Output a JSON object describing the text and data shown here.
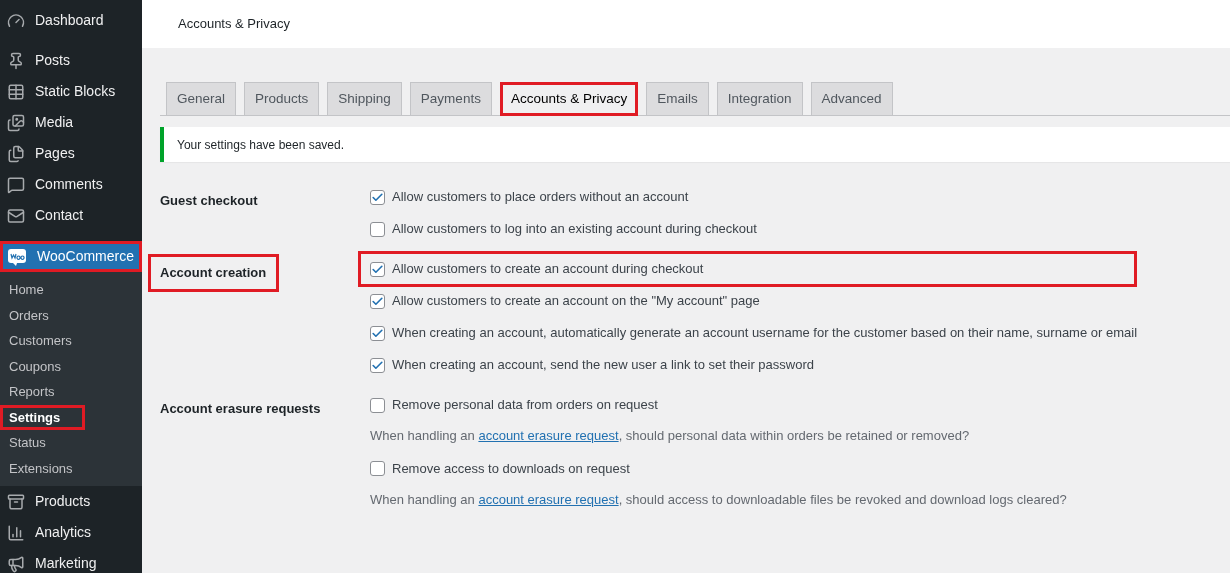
{
  "sidebar": {
    "sections": [
      {
        "items": [
          {
            "label": "Dashboard",
            "selected": false,
            "highlighted": false
          }
        ]
      },
      {
        "items": [
          {
            "label": "Posts",
            "selected": false,
            "highlighted": false
          },
          {
            "label": "Static Blocks",
            "selected": false,
            "highlighted": false
          },
          {
            "label": "Media",
            "selected": false,
            "highlighted": false
          },
          {
            "label": "Pages",
            "selected": false,
            "highlighted": false
          },
          {
            "label": "Comments",
            "selected": false,
            "highlighted": false
          },
          {
            "label": "Contact",
            "selected": false,
            "highlighted": false
          }
        ]
      },
      {
        "items": [
          {
            "label": "WooCommerce",
            "selected": true,
            "highlighted": true,
            "children": [
              {
                "label": "Home",
                "selected": false,
                "highlighted": false
              },
              {
                "label": "Orders",
                "selected": false,
                "highlighted": false
              },
              {
                "label": "Customers",
                "selected": false,
                "highlighted": false
              },
              {
                "label": "Coupons",
                "selected": false,
                "highlighted": false
              },
              {
                "label": "Reports",
                "selected": false,
                "highlighted": false
              },
              {
                "label": "Settings",
                "selected": true,
                "highlighted": true
              },
              {
                "label": "Status",
                "selected": false,
                "highlighted": false
              },
              {
                "label": "Extensions",
                "selected": false,
                "highlighted": false
              }
            ]
          },
          {
            "label": "Products",
            "selected": false,
            "highlighted": false
          },
          {
            "label": "Analytics",
            "selected": false,
            "highlighted": false
          },
          {
            "label": "Marketing",
            "selected": false,
            "highlighted": false
          }
        ]
      }
    ]
  },
  "header": {
    "title": "Accounts & Privacy"
  },
  "tabs": [
    {
      "label": "General",
      "selected": false,
      "highlighted": false
    },
    {
      "label": "Products",
      "selected": false,
      "highlighted": false
    },
    {
      "label": "Shipping",
      "selected": false,
      "highlighted": false
    },
    {
      "label": "Payments",
      "selected": false,
      "highlighted": false
    },
    {
      "label": "Accounts & Privacy",
      "selected": true,
      "highlighted": true
    },
    {
      "label": "Emails",
      "selected": false,
      "highlighted": false
    },
    {
      "label": "Integration",
      "selected": false,
      "highlighted": false
    },
    {
      "label": "Advanced",
      "selected": false,
      "highlighted": false
    }
  ],
  "notice": {
    "text": "Your settings have been saved."
  },
  "sections": [
    {
      "label": "Guest checkout",
      "highlighted": false,
      "options": [
        {
          "label": "Allow customers to place orders without an account",
          "checked": true,
          "highlighted": false
        },
        {
          "label": "Allow customers to log into an existing account during checkout",
          "checked": false,
          "highlighted": false
        }
      ]
    },
    {
      "label": "Account creation",
      "highlighted": true,
      "options": [
        {
          "label": "Allow customers to create an account during checkout",
          "checked": true,
          "highlighted": true
        },
        {
          "label": "Allow customers to create an account on the \"My account\" page",
          "checked": true,
          "highlighted": false
        },
        {
          "label": "When creating an account, automatically generate an account username for the customer based on their name, surname or email",
          "checked": true,
          "highlighted": false
        },
        {
          "label": "When creating an account, send the new user a link to set their password",
          "checked": true,
          "highlighted": false
        }
      ]
    },
    {
      "label": "Account erasure requests",
      "highlighted": false,
      "options": [
        {
          "label": "Remove personal data from orders on request",
          "checked": false,
          "highlighted": false,
          "help": {
            "before": "When handling an ",
            "link": "account erasure request",
            "after": ", should personal data within orders be retained or removed?"
          }
        },
        {
          "label": "Remove access to downloads on request",
          "checked": false,
          "highlighted": false,
          "help": {
            "before": "When handling an ",
            "link": "account erasure request",
            "after": ", should access to downloadable files be revoked and download logs cleared?"
          }
        }
      ]
    }
  ]
}
